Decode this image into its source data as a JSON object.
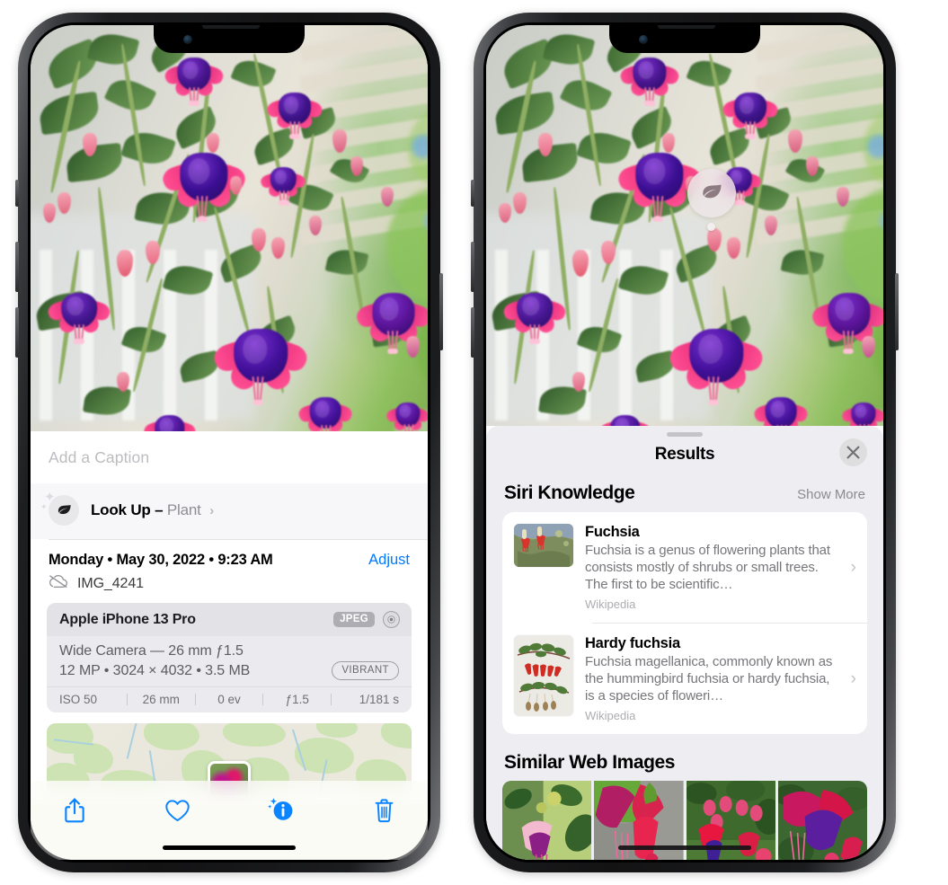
{
  "left_phone": {
    "caption": {
      "placeholder": "Add a Caption",
      "value": ""
    },
    "lookup": {
      "label": "Look Up –",
      "subject": "Plant",
      "chevron": "›",
      "icon": "leaf-icon"
    },
    "date": {
      "text": "Monday • May 30, 2022 • 9:23 AM",
      "adjust_label": "Adjust"
    },
    "file": {
      "name": "IMG_4241",
      "icon": "icloud-slash-icon"
    },
    "metadata": {
      "device": "Apple iPhone 13 Pro",
      "format_badge": "JPEG",
      "lens_icon": "camera-lens-icon",
      "lens_line": "Wide Camera — 26 mm ƒ1.5",
      "specs_line": "12 MP • 3024 × 4032 • 3.5 MB",
      "style_badge": "VIBRANT",
      "exif": [
        "ISO 50",
        "26 mm",
        "0 ev",
        "ƒ1.5",
        "1/181 s"
      ]
    },
    "toolbar": [
      {
        "name": "share-button",
        "icon": "share-icon"
      },
      {
        "name": "favorite-button",
        "icon": "heart-icon"
      },
      {
        "name": "info-button",
        "icon": "info-sparkle-icon"
      },
      {
        "name": "delete-button",
        "icon": "trash-icon"
      }
    ],
    "accent_color": "#007aff"
  },
  "right_phone": {
    "visual_lookup_badge": {
      "icon": "leaf-icon"
    },
    "sheet": {
      "title": "Results",
      "close_icon": "close-icon",
      "sections": [
        {
          "title": "Siri Knowledge",
          "action": "Show More",
          "items": [
            {
              "title": "Fuchsia",
              "description": "Fuchsia is a genus of flowering plants that consists mostly of shrubs or small trees. The first to be scientific…",
              "source": "Wikipedia",
              "chevron": "›"
            },
            {
              "title": "Hardy fuchsia",
              "description": "Fuchsia magellanica, commonly known as the hummingbird fuchsia or hardy fuchsia, is a species of floweri…",
              "source": "Wikipedia",
              "chevron": "›"
            }
          ]
        },
        {
          "title": "Similar Web Images",
          "items": [
            "web-image-1",
            "web-image-2",
            "web-image-3",
            "web-image-4"
          ]
        }
      ]
    }
  }
}
